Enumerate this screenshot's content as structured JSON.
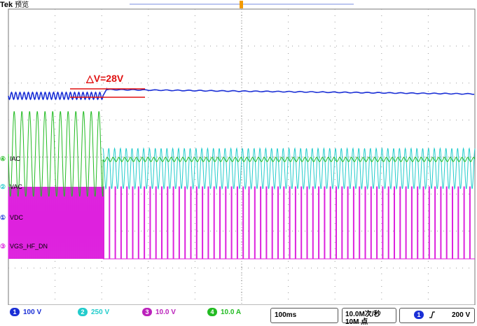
{
  "header": {
    "brand": "Tek",
    "mode": "预览"
  },
  "annotation": {
    "text": "△V=28V",
    "color": "#e01010"
  },
  "channels": [
    {
      "id": "4",
      "label": "IAC",
      "color": "#22bb22",
      "scale": "10.0 A"
    },
    {
      "id": "2",
      "label": "VAC",
      "color": "#22cccc",
      "scale": "250 V"
    },
    {
      "id": "1",
      "label": "VDC",
      "color": "#1a2fd6",
      "scale": "100 V"
    },
    {
      "id": "3",
      "label": "VGS_HF_DN",
      "color": "#dd22dd",
      "scale": "10.0 V"
    }
  ],
  "footer": {
    "ch1": {
      "num": "1",
      "scale": "100 V"
    },
    "ch2": {
      "num": "2",
      "scale": "250 V"
    },
    "ch3": {
      "num": "3",
      "scale": "10.0 V"
    },
    "ch4": {
      "num": "4",
      "scale": "10.0 A"
    },
    "timebase": "100ms",
    "sample_rate": "10.0M次/秒",
    "record_length": "10M 点",
    "trigger": {
      "channel": "1",
      "slope_icon": "rising-edge-icon",
      "level": "200 V"
    }
  },
  "colors": {
    "grid": "#9a9a9a",
    "ch1": "#1a2fd6",
    "ch2": "#22cccc",
    "ch3": "#dd22dd",
    "ch4": "#22bb22"
  }
}
